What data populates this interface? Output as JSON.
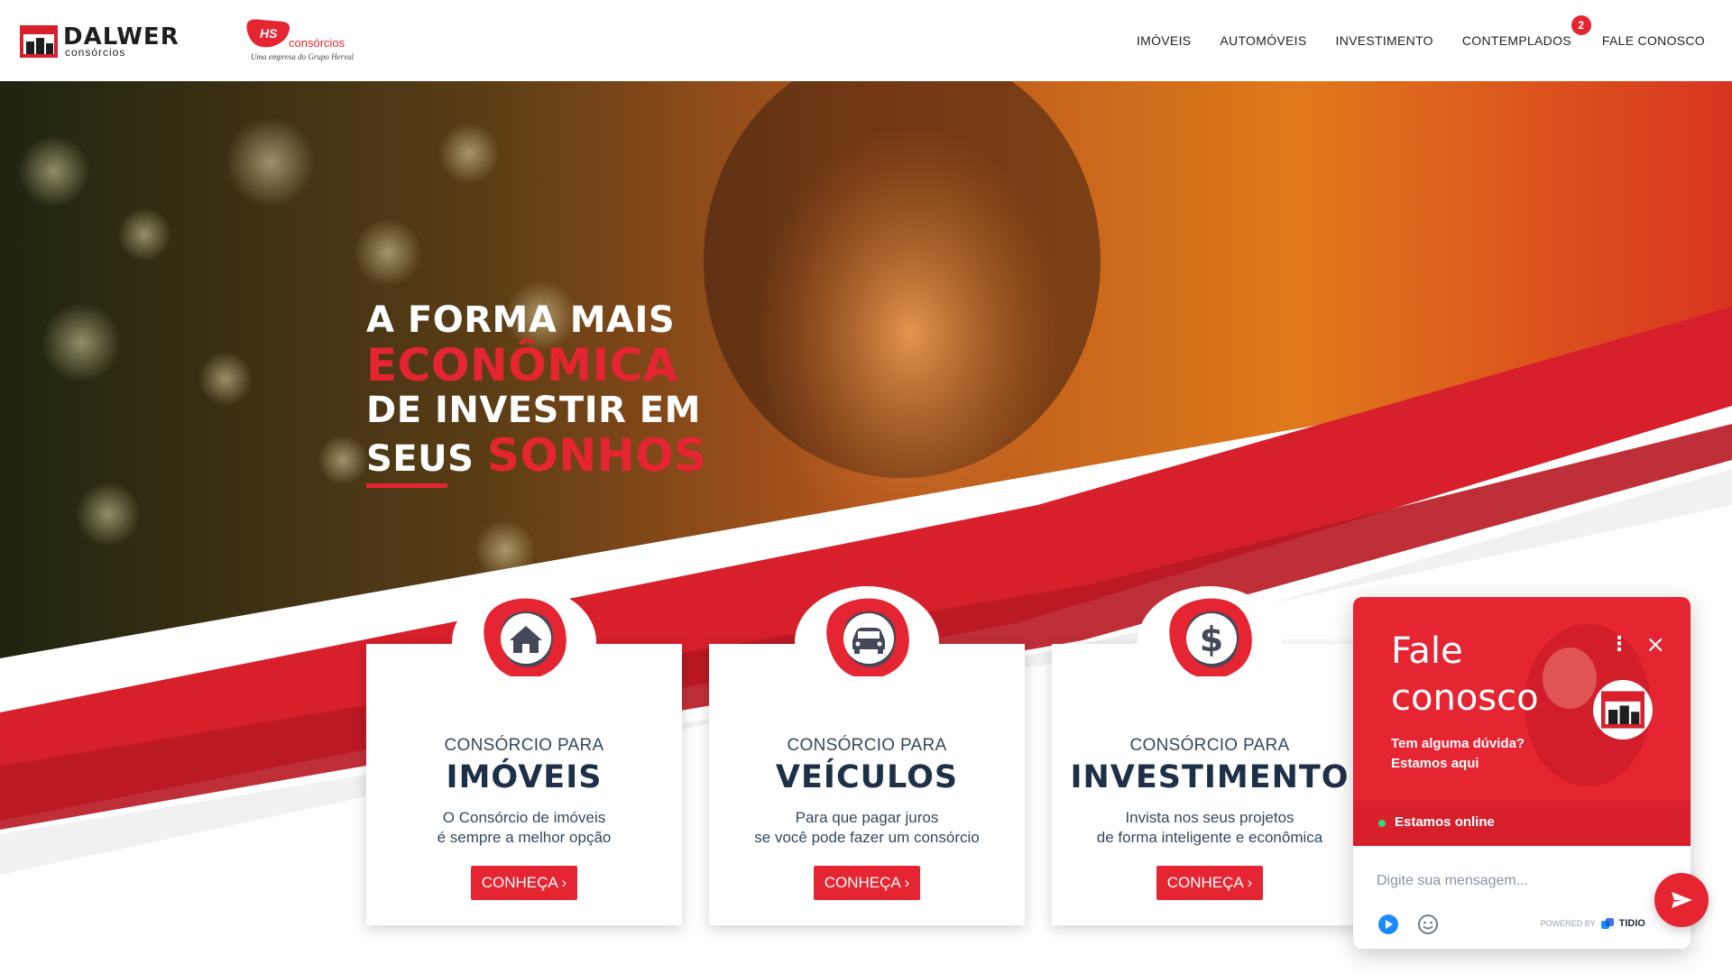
{
  "brand": {
    "dalwer_name": "DALWER",
    "dalwer_sub": "consórcios",
    "hs_name": "HS",
    "hs_sub": "consórcios",
    "hs_tagline": "Uma empresa do Grupo Herval"
  },
  "nav": {
    "items": [
      "IMÓVEIS",
      "AUTOMÓVEIS",
      "INVESTIMENTO",
      "CONTEMPLADOS",
      "FALE CONOSCO"
    ],
    "badge": "2"
  },
  "hero": {
    "line1": "A FORMA MAIS",
    "line2": "ECONÔMICA",
    "line3": "DE INVESTIR EM",
    "line4a": "SEUS",
    "line4b": "SONHOS"
  },
  "cards": [
    {
      "kicker": "CONSÓRCIO PARA",
      "title": "IMÓVEIS",
      "desc1": "O Consórcio de imóveis",
      "desc2": "é sempre a melhor opção",
      "button": "CONHEÇA",
      "icon": "house-icon"
    },
    {
      "kicker": "CONSÓRCIO PARA",
      "title": "VEÍCULOS",
      "desc1": "Para que pagar juros",
      "desc2": "se você pode fazer um consórcio",
      "button": "CONHEÇA",
      "icon": "car-icon"
    },
    {
      "kicker": "CONSÓRCIO PARA",
      "title": "INVESTIMENTO",
      "desc1": "Invista nos seus projetos",
      "desc2": "de forma inteligente e econômica",
      "button": "CONHEÇA",
      "icon": "dollar-icon"
    }
  ],
  "chat": {
    "title": "Fale conosco",
    "subtitle": "Tem alguma dúvida? Estamos aqui",
    "status": "Estamos online",
    "placeholder": "Digite sua mensagem...",
    "powered_by": "POWERED BY",
    "provider": "TIDIO"
  },
  "colors": {
    "brand_red": "#e52532",
    "dark_navy": "#1e3048",
    "online_green": "#37d67a"
  }
}
